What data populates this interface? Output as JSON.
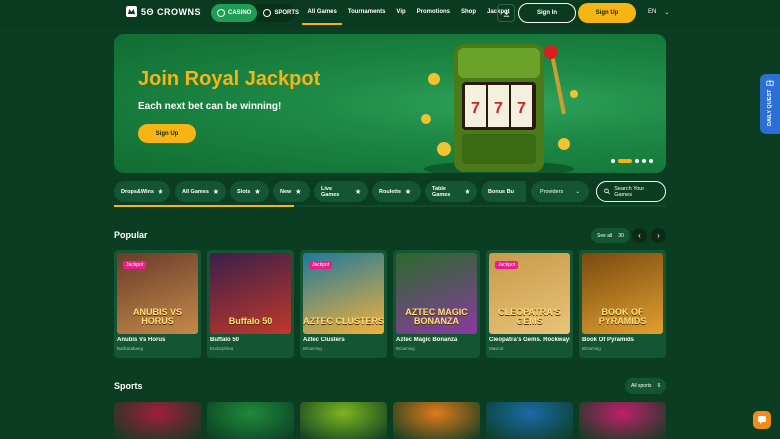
{
  "header": {
    "logo_text": "5Θ CROWNS",
    "modes": [
      "CASINO",
      "SPORTS"
    ],
    "nav": [
      "All Games",
      "Tournaments",
      "Vip",
      "Promotions",
      "Shop",
      "Jackpot"
    ],
    "signin": "Sign In",
    "signup": "Sign Up",
    "lang": "EN"
  },
  "banner": {
    "title": "Join Royal Jackpot",
    "subtitle": "Each next bet can be winning!",
    "cta": "Sign Up"
  },
  "filters": {
    "chips": [
      "Drops&Wins",
      "All Games",
      "Slots",
      "New",
      "Live Games",
      "Roulette",
      "Table Games",
      "Bonus Bu"
    ],
    "providers": "Providers",
    "search_placeholder": "Search Your Games"
  },
  "popular": {
    "title": "Popular",
    "see_all": "See all",
    "count": "30",
    "games": [
      {
        "name": "Anubis Vs Horus",
        "provider": "Barbarabang",
        "badge": "Jackpot",
        "art": "ANUBIS VS HORUS",
        "color1": "#6a3c2a",
        "color2": "#c48a4a"
      },
      {
        "name": "Buffalo 50",
        "provider": "Endorphina",
        "badge": "",
        "art": "Buffalo 50",
        "color1": "#3a1f4a",
        "color2": "#c0392b"
      },
      {
        "name": "Aztec Clusters",
        "provider": "BGaming",
        "badge": "Jackpot",
        "art": "AZTEC CLUSTERS",
        "color1": "#1e7a9a",
        "color2": "#f2b13a"
      },
      {
        "name": "Aztec Magic Bonanza",
        "provider": "BGaming",
        "badge": "",
        "art": "AZTEC MAGIC BONANZA",
        "color1": "#2a6a2a",
        "color2": "#8a3aa0"
      },
      {
        "name": "Cleopatra's Gems. Rockways",
        "provider": "Mascot",
        "badge": "Jackpot",
        "art": "CLEOPATRA'S GEMS",
        "color1": "#c99a4a",
        "color2": "#e8c37a"
      },
      {
        "name": "Book Of Pyramids",
        "provider": "BGaming",
        "badge": "",
        "art": "BOOK OF PYRAMIDS",
        "color1": "#7a4a10",
        "color2": "#e0a030"
      }
    ]
  },
  "sports": {
    "title": "Sports",
    "all_label": "All sports",
    "count": "6",
    "tiles": [
      {
        "color": "#a11e3a"
      },
      {
        "color": "#1f8a3c"
      },
      {
        "color": "#7fb51f"
      },
      {
        "color": "#e07a1a"
      },
      {
        "color": "#1a6aa8"
      },
      {
        "color": "#c0206a"
      }
    ]
  },
  "quest": "DAILY QUEST",
  "colors": {
    "accent": "#f7b514",
    "bg": "#0b3d22",
    "card": "#145534"
  }
}
